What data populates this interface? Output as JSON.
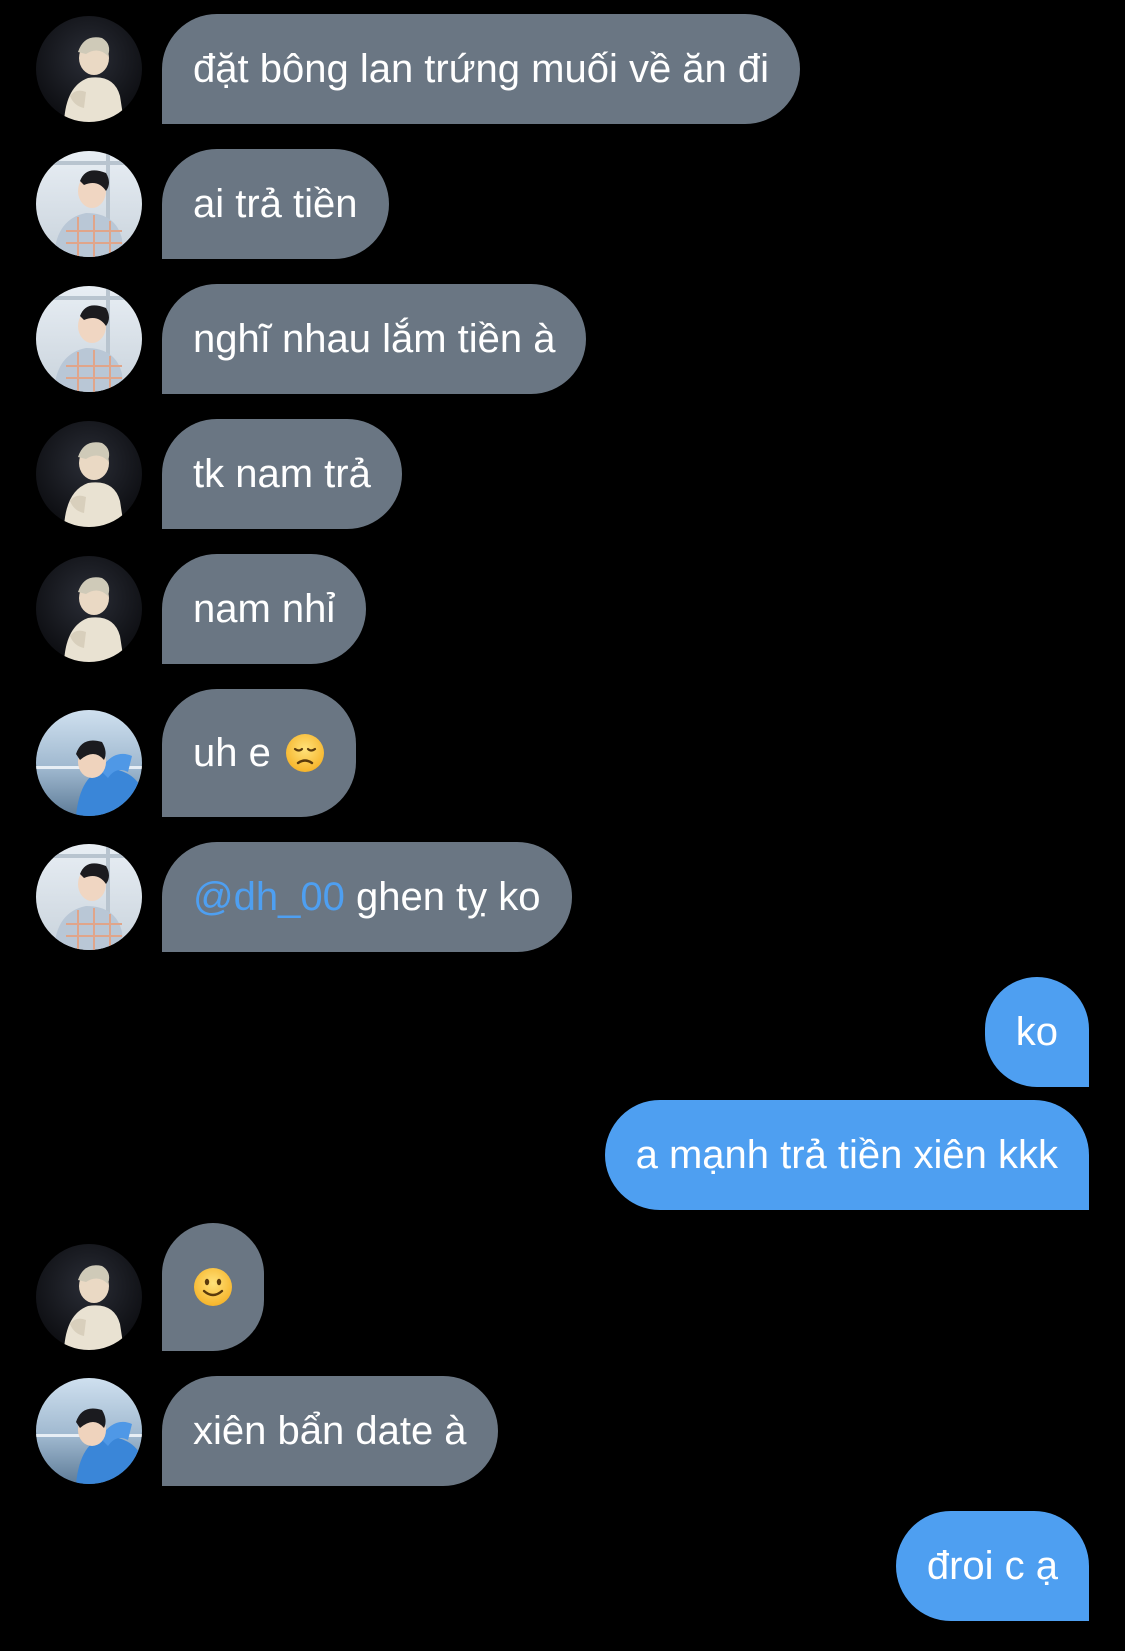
{
  "conversation": {
    "messages": [
      {
        "sender": "avatar-1",
        "text": "đặt bông lan trứng muối về ăn đi"
      },
      {
        "sender": "avatar-2",
        "text": "ai trả tiền"
      },
      {
        "sender": "avatar-2",
        "text": "nghĩ nhau lắm tiền à"
      },
      {
        "sender": "avatar-1",
        "text": "tk nam trả"
      },
      {
        "sender": "avatar-1",
        "text": "nam nhỉ"
      },
      {
        "sender": "avatar-3",
        "text": "uh e",
        "emoji": "disappointed-face-emoji"
      },
      {
        "sender": "avatar-2",
        "mention": "@dh_00",
        "text": " ghen tỵ ko"
      },
      {
        "sender": "me",
        "text": "ko"
      },
      {
        "sender": "me",
        "text": "a mạnh trả tiền xiên kkk"
      },
      {
        "sender": "avatar-1",
        "emoji": "slightly-smiling-face-emoji"
      },
      {
        "sender": "avatar-3",
        "text": "xiên bẩn date à"
      },
      {
        "sender": "me",
        "text": "đroi c ạ"
      }
    ]
  },
  "colors": {
    "background": "#000000",
    "incoming_bubble": "#6a7683",
    "outgoing_bubble": "#4e9ff1",
    "mention": "#4e9ff1",
    "text": "#ffffff"
  }
}
